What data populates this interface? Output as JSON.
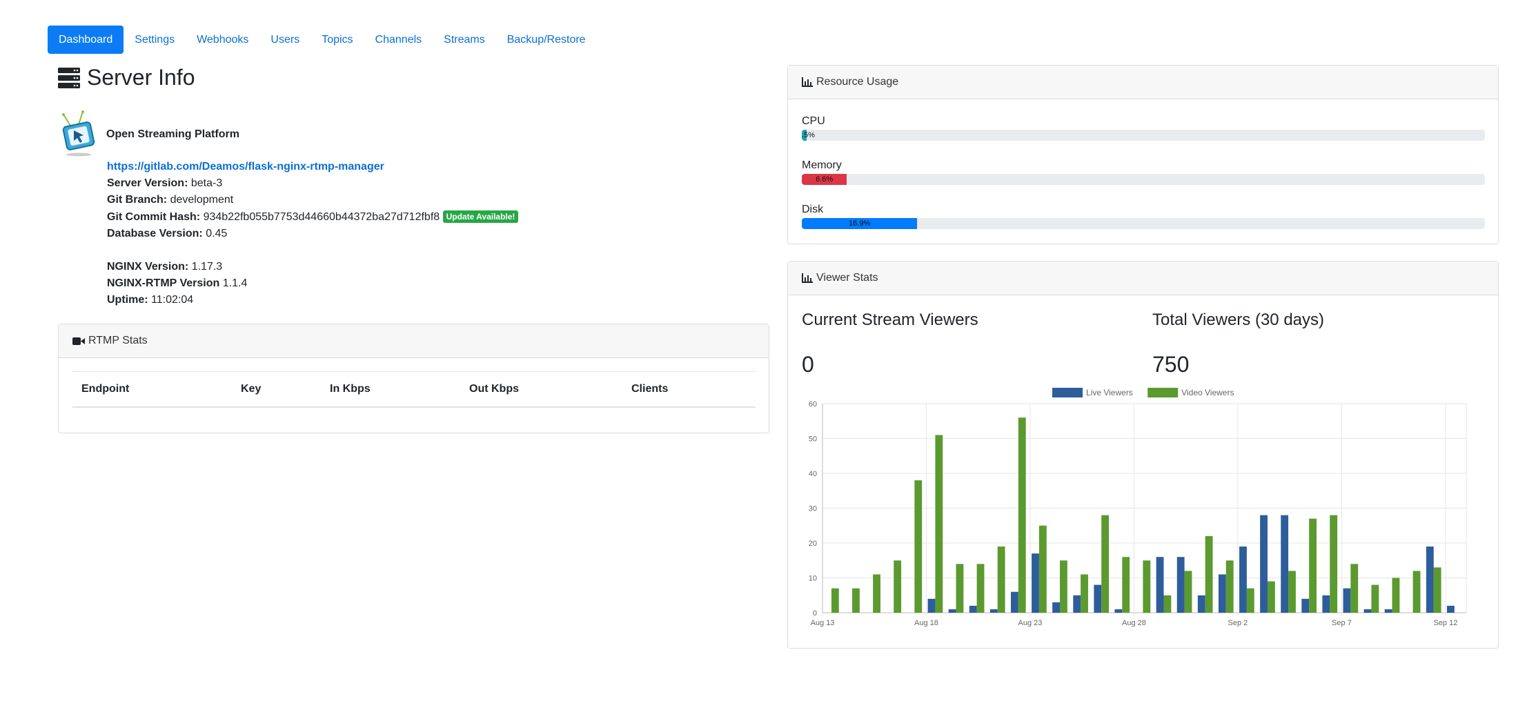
{
  "nav": {
    "items": [
      {
        "label": "Dashboard",
        "active": true
      },
      {
        "label": "Settings"
      },
      {
        "label": "Webhooks"
      },
      {
        "label": "Users"
      },
      {
        "label": "Topics"
      },
      {
        "label": "Channels"
      },
      {
        "label": "Streams"
      },
      {
        "label": "Backup/Restore"
      }
    ]
  },
  "server_info": {
    "title": "Server Info",
    "platform_name": "Open Streaming Platform",
    "repo_link": "https://gitlab.com/Deamos/flask-nginx-rtmp-manager",
    "server_version_label": "Server Version:",
    "server_version": "beta-3",
    "git_branch_label": "Git Branch:",
    "git_branch": "development",
    "git_commit_label": "Git Commit Hash:",
    "git_commit": "934b22fb055b7753d44660b44372ba27d712fbf8",
    "update_badge": "Update Available!",
    "db_version_label": "Database Version:",
    "db_version": "0.45",
    "nginx_label": "NGINX Version:",
    "nginx_version": "1.17.3",
    "nginx_rtmp_label": "NGINX-RTMP Version",
    "nginx_rtmp_version": "1.1.4",
    "uptime_label": "Uptime:",
    "uptime": "11:02:04"
  },
  "rtmp_stats": {
    "title": "RTMP Stats",
    "columns": [
      "Endpoint",
      "Key",
      "In Kbps",
      "Out Kbps",
      "Clients"
    ]
  },
  "resource_usage": {
    "title": "Resource Usage",
    "items": [
      {
        "label": "CPU",
        "value": 0.5,
        "text": ".5%",
        "color": "#17a2b8"
      },
      {
        "label": "Memory",
        "value": 6.6,
        "text": "6.6%",
        "color": "#dc3545"
      },
      {
        "label": "Disk",
        "value": 16.9,
        "text": "16.9%",
        "color": "#007bff"
      }
    ]
  },
  "viewer_stats": {
    "title": "Viewer Stats",
    "current_label": "Current Stream Viewers",
    "current_value": "0",
    "total_label": "Total Viewers (30 days)",
    "total_value": "750"
  },
  "colors": {
    "accent": "#0b7cf5",
    "live": "#2d5d9a",
    "video": "#5b9a2f",
    "badge": "#28a745"
  },
  "chart_data": {
    "type": "bar",
    "x": [
      "Aug 13",
      "Aug 14",
      "Aug 15",
      "Aug 16",
      "Aug 17",
      "Aug 18",
      "Aug 19",
      "Aug 20",
      "Aug 21",
      "Aug 22",
      "Aug 23",
      "Aug 24",
      "Aug 25",
      "Aug 26",
      "Aug 27",
      "Aug 28",
      "Aug 29",
      "Aug 30",
      "Aug 31",
      "Sep 1",
      "Sep 2",
      "Sep 3",
      "Sep 4",
      "Sep 5",
      "Sep 6",
      "Sep 7",
      "Sep 8",
      "Sep 9",
      "Sep 10",
      "Sep 11",
      "Sep 12"
    ],
    "xticks": [
      "Aug 13",
      "Aug 18",
      "Aug 23",
      "Aug 28",
      "Sep 2",
      "Sep 7",
      "Sep 12"
    ],
    "series": [
      {
        "name": "Live Viewers",
        "color": "#2d5d9a",
        "values": [
          0,
          0,
          0,
          0,
          0,
          4,
          1,
          2,
          1,
          6,
          17,
          3,
          5,
          8,
          1,
          0,
          16,
          16,
          5,
          11,
          19,
          28,
          28,
          4,
          5,
          7,
          1,
          1,
          0,
          19,
          2
        ]
      },
      {
        "name": "Video Viewers",
        "color": "#5b9a2f",
        "values": [
          7,
          7,
          11,
          15,
          38,
          51,
          14,
          14,
          19,
          56,
          25,
          15,
          11,
          28,
          16,
          15,
          5,
          12,
          22,
          15,
          7,
          9,
          12,
          27,
          28,
          14,
          8,
          10,
          12,
          13,
          0
        ]
      }
    ],
    "ylim": [
      0,
      60
    ],
    "yticks": [
      0,
      10,
      20,
      30,
      40,
      50,
      60
    ],
    "legend": "top",
    "grid": true
  }
}
